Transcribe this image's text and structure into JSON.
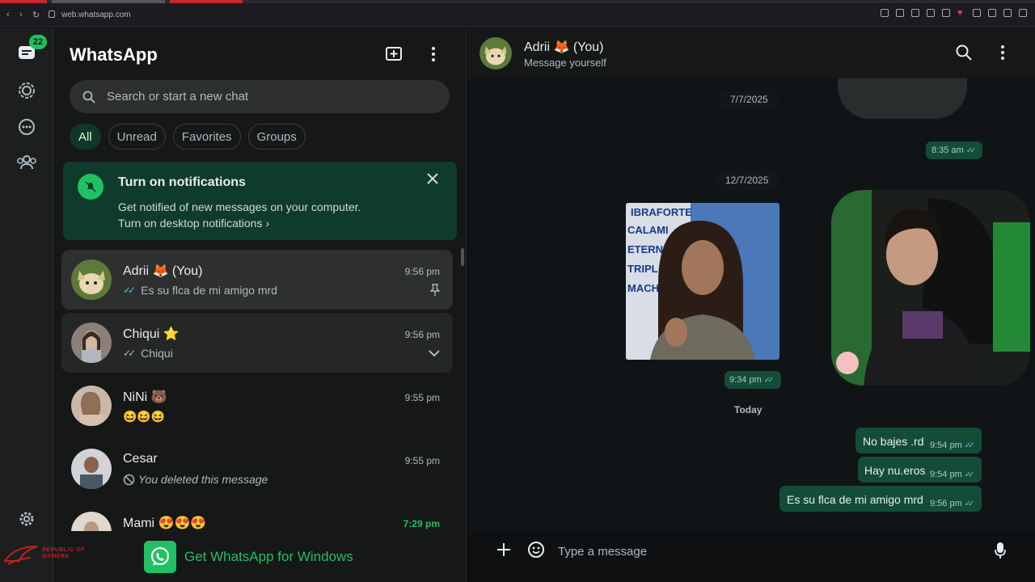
{
  "browser": {
    "url": "web.whatsapp.com"
  },
  "rail": {
    "badge_count": "22"
  },
  "sidebar": {
    "title": "WhatsApp",
    "search_placeholder": "Search or start a new chat",
    "filters": [
      "All",
      "Unread",
      "Favorites",
      "Groups"
    ],
    "notification": {
      "title": "Turn on notifications",
      "description": "Get notified of new messages on your computer.",
      "link": "Turn on desktop notifications"
    },
    "chats": [
      {
        "name": "Adrii 🦊 (You)",
        "time": "9:56 pm",
        "preview": "Es su flca de mi amigo mrd"
      },
      {
        "name": "Chiqui ⭐",
        "time": "9:56 pm",
        "preview": "Chiqui"
      },
      {
        "name": "NiNi 🐻",
        "time": "9:55 pm",
        "preview": "😆😆😆"
      },
      {
        "name": "Cesar",
        "time": "9:55 pm",
        "preview": "You deleted this message"
      },
      {
        "name": "Mami 😍😍😍",
        "time": "7:29 pm",
        "preview": ""
      }
    ],
    "get_app": "Get WhatsApp for Windows"
  },
  "conversation": {
    "name": "Adrii 🦊 (You)",
    "status": "Message yourself",
    "dates": [
      "7/7/2025",
      "12/7/2025",
      "Today"
    ],
    "messages": [
      {
        "text": "",
        "time": "8:35 am"
      },
      {
        "text": "",
        "time": "9:34 pm"
      },
      {
        "text": "No bajes .rd",
        "time": "9:54 pm"
      },
      {
        "text": "Hay nu.eros",
        "time": "9:54 pm"
      },
      {
        "text": "Es su flca de mi amigo mrd",
        "time": "9:56 pm"
      }
    ],
    "composer_placeholder": "Type a message"
  },
  "overlay": {
    "brand": "REPUBLIC OF GAMERS"
  },
  "colors": {
    "accent": "#21c063",
    "bubble": "#144d37",
    "read_ticks": "#53bdeb"
  }
}
